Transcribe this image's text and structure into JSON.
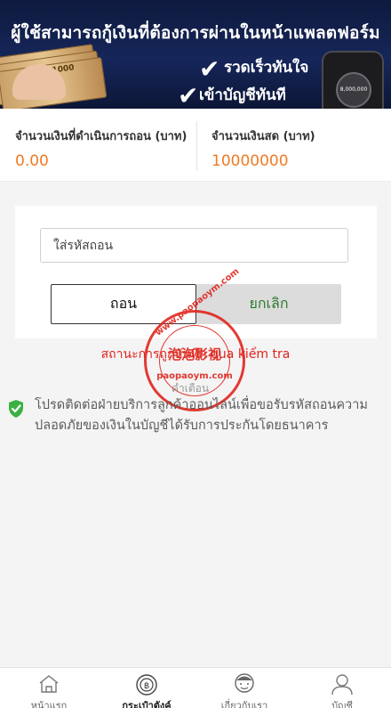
{
  "banner": {
    "title": "ผู้ใช้สามารถกู้เงินที่ต้องการผ่านในหน้าแพลตฟอร์ม",
    "line1": "รวดเร็วทันใจ",
    "line2": "เข้าบัญชีทันที",
    "bill_text": "1000",
    "phone_amount": "8,000,000"
  },
  "summary": {
    "withdraw_label": "จำนวนเงินที่ดำเนินการถอน (บาท)",
    "withdraw_value": "0.00",
    "cash_label": "จำนวนเงินสด (บาท)",
    "cash_value": "10000000"
  },
  "form": {
    "code_placeholder": "ใส่รหัสถอน",
    "withdraw_button": "ถอน",
    "cancel_button": "ยกเลิก"
  },
  "status_text": "สถานะการถูกบันทึก qua kiểm tra",
  "watermark": {
    "top": "www.paopaoym.com",
    "middle": "泡泡影视",
    "bottom": "paopaoym.com"
  },
  "faint_text": "คำเตือน",
  "notice": "โปรดติดต่อฝ่ายบริการลูกค้าออนไลน์เพื่อขอรับรหัสถอนความปลอดภัยของเงินในบัญชีได้รับการประกันโดยธนาคาร",
  "nav": {
    "items": [
      {
        "label": "หน้าแรก"
      },
      {
        "label": "กระเป๋าตังค์"
      },
      {
        "label": "เกี่ยวกับเรา"
      },
      {
        "label": "บัญชี"
      }
    ]
  },
  "colors": {
    "accent_orange": "#ef7b24",
    "status_red": "#e0231c",
    "cancel_green": "#2e7a2e",
    "shield_green": "#3cb043"
  }
}
